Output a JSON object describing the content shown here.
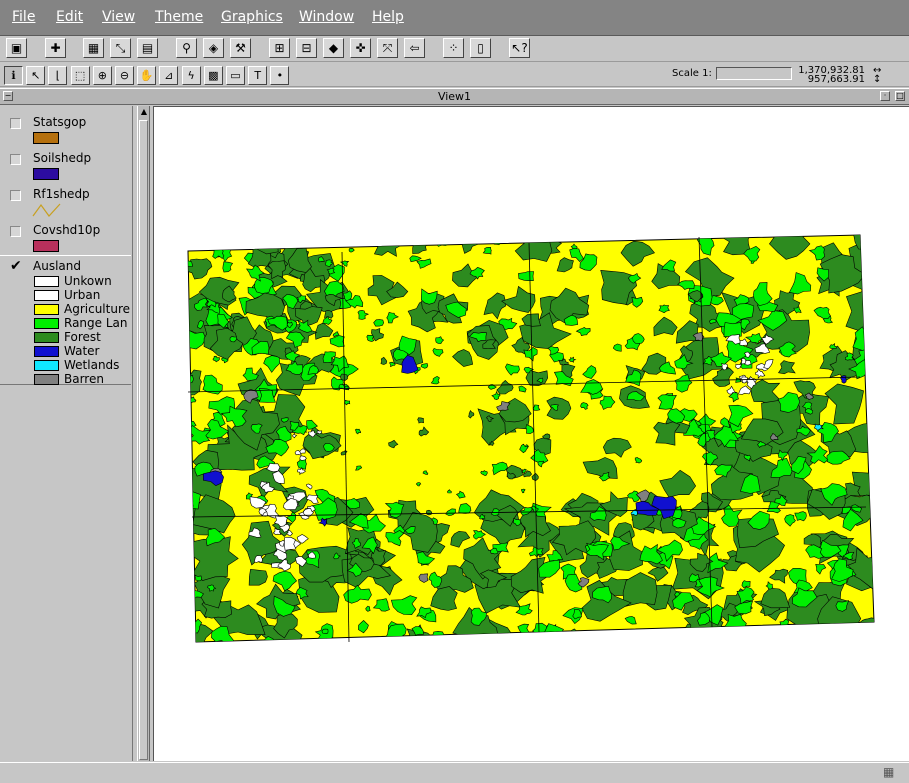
{
  "menu": [
    "File",
    "Edit",
    "View",
    "Theme",
    "Graphics",
    "Window",
    "Help"
  ],
  "toolbar_buttons": [
    {
      "name": "save-icon",
      "glyph": "▣"
    },
    {
      "name": "add-theme-icon",
      "glyph": "✚"
    },
    {
      "name": "theme-properties-icon",
      "glyph": "▦"
    },
    {
      "name": "edit-legend-icon",
      "glyph": "⤡"
    },
    {
      "name": "open-table-icon",
      "glyph": "▤"
    },
    {
      "name": "find-icon",
      "glyph": "⚲"
    },
    {
      "name": "locate-address-icon",
      "glyph": "◈"
    },
    {
      "name": "query-builder-icon",
      "glyph": "⚒"
    },
    {
      "name": "zoom-full-extent-icon",
      "glyph": "⊞"
    },
    {
      "name": "zoom-active-themes-icon",
      "glyph": "⊟"
    },
    {
      "name": "zoom-selected-icon",
      "glyph": "◆"
    },
    {
      "name": "zoom-in-fixed-icon",
      "glyph": "✜"
    },
    {
      "name": "zoom-out-fixed-icon",
      "glyph": "⤧"
    },
    {
      "name": "zoom-previous-icon",
      "glyph": "⇦"
    },
    {
      "name": "select-by-graphic-icon",
      "glyph": "⁘"
    },
    {
      "name": "clear-selected-icon",
      "glyph": "▯"
    },
    {
      "name": "help-icon",
      "glyph": "↖?"
    }
  ],
  "tools": [
    {
      "name": "identify-tool-icon",
      "glyph": "ℹ",
      "active": true
    },
    {
      "name": "pointer-tool-icon",
      "glyph": "↖",
      "active": false
    },
    {
      "name": "vertex-edit-tool-icon",
      "glyph": "⌊",
      "active": false
    },
    {
      "name": "select-feature-tool-icon",
      "glyph": "⬚",
      "active": false
    },
    {
      "name": "zoom-in-tool-icon",
      "glyph": "⊕",
      "active": false
    },
    {
      "name": "zoom-out-tool-icon",
      "glyph": "⊖",
      "active": false
    },
    {
      "name": "pan-tool-icon",
      "glyph": "✋",
      "active": false
    },
    {
      "name": "measure-tool-icon",
      "glyph": "⊿",
      "active": false
    },
    {
      "name": "hotlink-tool-icon",
      "glyph": "ϟ",
      "active": false
    },
    {
      "name": "area-of-interest-tool-icon",
      "glyph": "▩",
      "active": false
    },
    {
      "name": "label-tool-icon",
      "glyph": "▭",
      "active": false
    },
    {
      "name": "text-tool-icon",
      "glyph": "T",
      "active": false
    },
    {
      "name": "draw-point-tool-icon",
      "glyph": "•",
      "active": false
    }
  ],
  "scale": {
    "label": "Scale 1:",
    "value": ""
  },
  "coords": {
    "x": "1,370,932.81",
    "y": "957,663.91"
  },
  "window": {
    "title": "View1"
  },
  "colors": {
    "agriculture": "#ffff00",
    "range": "#00f000",
    "forest": "#2d8b1f",
    "water": "#1010d0",
    "wetlands": "#10e8ff",
    "barren": "#808080",
    "urban": "#ffffff",
    "unknown": "#ffffff"
  },
  "themes": [
    {
      "name": "Statsgop",
      "checked": false,
      "symbol": "fill",
      "color": "#b5700e"
    },
    {
      "name": "Soilshedp",
      "checked": false,
      "symbol": "fill",
      "color": "#2c0ca0"
    },
    {
      "name": "Rf1shedp",
      "checked": false,
      "symbol": "line",
      "color": "#c8a020"
    },
    {
      "name": "Covshd10p",
      "checked": false,
      "symbol": "fill",
      "color": "#b8305c"
    },
    {
      "name": "Ausland",
      "checked": true,
      "symbol": "legend",
      "classes": [
        {
          "label": "Unkown",
          "color": "#ffffff"
        },
        {
          "label": "Urban",
          "color": "#ffffff"
        },
        {
          "label": "Agriculture",
          "color": "#ffff00"
        },
        {
          "label": "Range Lan",
          "color": "#00f000"
        },
        {
          "label": "Forest",
          "color": "#2d8b1f"
        },
        {
          "label": "Water",
          "color": "#1010d0"
        },
        {
          "label": "Wetlands",
          "color": "#10e8ff"
        },
        {
          "label": "Barren",
          "color": "#808080"
        }
      ]
    }
  ]
}
